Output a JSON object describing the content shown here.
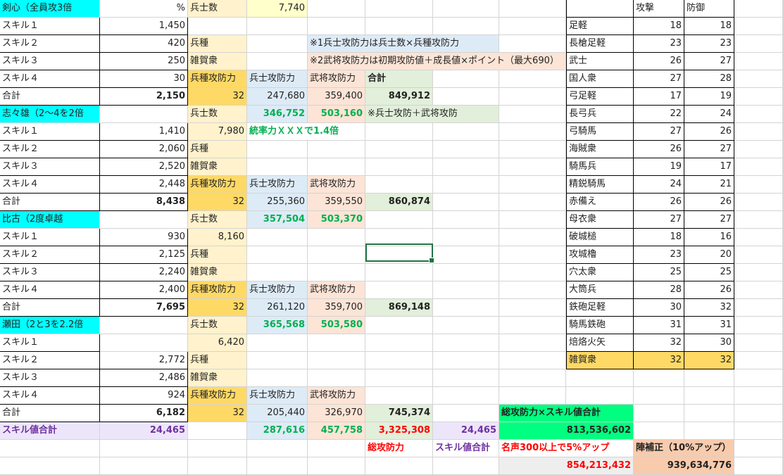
{
  "colors": {
    "cyan": "#00ffff",
    "light_yellow": "#fff2cc",
    "yellow_soft": "#ffffcc",
    "gold": "#ffd966",
    "light_blue": "#ddebf7",
    "peach": "#fce4d6",
    "light_green": "#e2efda",
    "lavender": "#ede6fb",
    "bright_green": "#00ff80",
    "salary_peach": "#f8cbad",
    "grey": "#eeeeee",
    "text_green": "#00b050",
    "text_red": "#ff0000",
    "text_purple": "#7030a0"
  },
  "cells": [
    {
      "t": "剣心（全員攻3倍",
      "c": "A",
      "r": 1,
      "bg": "cyan"
    },
    {
      "t": "%",
      "c": "B",
      "r": 1,
      "a": "r",
      "bg": "white"
    },
    {
      "t": "兵士数",
      "c": "C",
      "r": 1,
      "bg": "light_yellow"
    },
    {
      "t": "7,740",
      "c": "D",
      "r": 1,
      "a": "r",
      "bg": "yellow_soft"
    },
    {
      "t": "スキル１",
      "c": "A",
      "r": 2,
      "bd": 1
    },
    {
      "t": "1,450",
      "c": "B",
      "r": 2,
      "a": "r",
      "bd": 1
    },
    {
      "t": "スキル２",
      "c": "A",
      "r": 3,
      "bd": 1
    },
    {
      "t": "420",
      "c": "B",
      "r": 3,
      "a": "r",
      "bd": 1
    },
    {
      "t": "兵種",
      "c": "C",
      "r": 3,
      "bg": "light_yellow"
    },
    {
      "t": "※1兵士攻防力は兵士数×兵種攻防力",
      "c": "E",
      "r": 3,
      "span": 3,
      "bg": "light_blue"
    },
    {
      "t": "スキル３",
      "c": "A",
      "r": 4,
      "bd": 1
    },
    {
      "t": "250",
      "c": "B",
      "r": 4,
      "a": "r",
      "bd": 1
    },
    {
      "t": "雑賀衆",
      "c": "C",
      "r": 4,
      "bg": "light_yellow"
    },
    {
      "t": "※2武将攻防力は初期攻防値＋成長値×ポイント（最大690）",
      "c": "E",
      "r": 4,
      "span": 4,
      "bg": "peach"
    },
    {
      "t": "スキル４",
      "c": "A",
      "r": 5,
      "bd": 1
    },
    {
      "t": "30",
      "c": "B",
      "r": 5,
      "a": "r",
      "bd": 1
    },
    {
      "t": "兵種攻防力",
      "c": "C",
      "r": 5,
      "bg": "gold"
    },
    {
      "t": "兵士攻防力",
      "c": "D",
      "r": 5,
      "bg": "light_blue"
    },
    {
      "t": "武将攻防力",
      "c": "E",
      "r": 5,
      "bg": "peach"
    },
    {
      "t": "合計",
      "c": "F",
      "r": 5,
      "b": 1,
      "bg": "light_green"
    },
    {
      "t": "合計",
      "c": "A",
      "r": 6,
      "bd": 1
    },
    {
      "t": "2,150",
      "c": "B",
      "r": 6,
      "a": "r",
      "b": 1,
      "bd": 1
    },
    {
      "t": "32",
      "c": "C",
      "r": 6,
      "a": "r",
      "bg": "gold"
    },
    {
      "t": "247,680",
      "c": "D",
      "r": 6,
      "a": "r",
      "bg": "light_blue"
    },
    {
      "t": "359,400",
      "c": "E",
      "r": 6,
      "a": "r",
      "bg": "peach"
    },
    {
      "t": "849,912",
      "c": "F",
      "r": 6,
      "a": "r",
      "b": 1,
      "bg": "light_green"
    },
    {
      "t": "志々雄（2～4を2倍",
      "c": "A",
      "r": 7,
      "bg": "cyan"
    },
    {
      "t": "兵士数",
      "c": "C",
      "r": 7,
      "bg": "light_yellow"
    },
    {
      "t": "346,752",
      "c": "D",
      "r": 7,
      "a": "r",
      "b": 1,
      "fg": "text_green",
      "bg": "light_blue"
    },
    {
      "t": "503,160",
      "c": "E",
      "r": 7,
      "a": "r",
      "b": 1,
      "fg": "text_green",
      "bg": "peach"
    },
    {
      "t": "※兵士攻防＋武将攻防",
      "c": "F",
      "r": 7,
      "span": 2,
      "bg": "light_green"
    },
    {
      "t": "スキル１",
      "c": "A",
      "r": 8,
      "bd": 1
    },
    {
      "t": "1,410",
      "c": "B",
      "r": 8,
      "a": "r",
      "bd": 1
    },
    {
      "t": "7,980",
      "c": "C",
      "r": 8,
      "a": "r",
      "bg": "light_yellow"
    },
    {
      "t": "統率力ＸＸＸで1.4倍",
      "c": "D",
      "r": 8,
      "span": 2,
      "b": 1,
      "fg": "text_green"
    },
    {
      "t": "スキル２",
      "c": "A",
      "r": 9,
      "bd": 1
    },
    {
      "t": "2,060",
      "c": "B",
      "r": 9,
      "a": "r",
      "bd": 1
    },
    {
      "t": "兵種",
      "c": "C",
      "r": 9,
      "bg": "light_yellow"
    },
    {
      "t": "スキル３",
      "c": "A",
      "r": 10,
      "bd": 1
    },
    {
      "t": "2,520",
      "c": "B",
      "r": 10,
      "a": "r",
      "bd": 1
    },
    {
      "t": "雑賀衆",
      "c": "C",
      "r": 10,
      "bg": "light_yellow"
    },
    {
      "t": "スキル４",
      "c": "A",
      "r": 11,
      "bd": 1
    },
    {
      "t": "2,448",
      "c": "B",
      "r": 11,
      "a": "r",
      "bd": 1
    },
    {
      "t": "兵種攻防力",
      "c": "C",
      "r": 11,
      "bg": "gold"
    },
    {
      "t": "兵士攻防力",
      "c": "D",
      "r": 11,
      "bg": "light_blue"
    },
    {
      "t": "武将攻防力",
      "c": "E",
      "r": 11,
      "bg": "peach"
    },
    {
      "t": "合計",
      "c": "A",
      "r": 12,
      "bd": 1
    },
    {
      "t": "8,438",
      "c": "B",
      "r": 12,
      "a": "r",
      "b": 1,
      "bd": 1
    },
    {
      "t": "32",
      "c": "C",
      "r": 12,
      "a": "r",
      "bg": "gold"
    },
    {
      "t": "255,360",
      "c": "D",
      "r": 12,
      "a": "r",
      "bg": "light_blue"
    },
    {
      "t": "359,550",
      "c": "E",
      "r": 12,
      "a": "r",
      "bg": "peach"
    },
    {
      "t": "860,874",
      "c": "F",
      "r": 12,
      "a": "r",
      "b": 1,
      "bg": "light_green"
    },
    {
      "t": "比古（2度卓越",
      "c": "A",
      "r": 13,
      "bg": "cyan"
    },
    {
      "t": "兵士数",
      "c": "C",
      "r": 13,
      "bg": "light_yellow"
    },
    {
      "t": "357,504",
      "c": "D",
      "r": 13,
      "a": "r",
      "b": 1,
      "fg": "text_green",
      "bg": "light_blue"
    },
    {
      "t": "503,370",
      "c": "E",
      "r": 13,
      "a": "r",
      "b": 1,
      "fg": "text_green",
      "bg": "peach"
    },
    {
      "t": "スキル１",
      "c": "A",
      "r": 14,
      "bd": 1
    },
    {
      "t": "930",
      "c": "B",
      "r": 14,
      "a": "r",
      "bd": 1
    },
    {
      "t": "8,160",
      "c": "C",
      "r": 14,
      "a": "r",
      "bg": "light_yellow"
    },
    {
      "t": "スキル２",
      "c": "A",
      "r": 15,
      "bd": 1
    },
    {
      "t": "2,125",
      "c": "B",
      "r": 15,
      "a": "r",
      "bd": 1
    },
    {
      "t": "兵種",
      "c": "C",
      "r": 15,
      "bg": "light_yellow"
    },
    {
      "t": "スキル３",
      "c": "A",
      "r": 16,
      "bd": 1
    },
    {
      "t": "2,240",
      "c": "B",
      "r": 16,
      "a": "r",
      "bd": 1
    },
    {
      "t": "雑賀衆",
      "c": "C",
      "r": 16,
      "bg": "light_yellow"
    },
    {
      "t": "スキル４",
      "c": "A",
      "r": 17,
      "bd": 1
    },
    {
      "t": "2,400",
      "c": "B",
      "r": 17,
      "a": "r",
      "bd": 1
    },
    {
      "t": "兵種攻防力",
      "c": "C",
      "r": 17,
      "bg": "gold"
    },
    {
      "t": "兵士攻防力",
      "c": "D",
      "r": 17,
      "bg": "light_blue"
    },
    {
      "t": "武将攻防力",
      "c": "E",
      "r": 17,
      "bg": "peach"
    },
    {
      "t": "合計",
      "c": "A",
      "r": 18,
      "bd": 1
    },
    {
      "t": "7,695",
      "c": "B",
      "r": 18,
      "a": "r",
      "b": 1,
      "bd": 1
    },
    {
      "t": "32",
      "c": "C",
      "r": 18,
      "a": "r",
      "bg": "gold"
    },
    {
      "t": "261,120",
      "c": "D",
      "r": 18,
      "a": "r",
      "bg": "light_blue"
    },
    {
      "t": "359,700",
      "c": "E",
      "r": 18,
      "a": "r",
      "bg": "peach"
    },
    {
      "t": "869,148",
      "c": "F",
      "r": 18,
      "a": "r",
      "b": 1,
      "bg": "light_green"
    },
    {
      "t": "瀬田（2と3を2.2倍",
      "c": "A",
      "r": 19,
      "bg": "cyan"
    },
    {
      "t": "兵士数",
      "c": "C",
      "r": 19,
      "bg": "light_yellow"
    },
    {
      "t": "365,568",
      "c": "D",
      "r": 19,
      "a": "r",
      "b": 1,
      "fg": "text_green",
      "bg": "light_blue"
    },
    {
      "t": "503,580",
      "c": "E",
      "r": 19,
      "a": "r",
      "b": 1,
      "fg": "text_green",
      "bg": "peach"
    },
    {
      "t": "スキル１",
      "c": "A",
      "r": 20,
      "bd": 1
    },
    {
      "t": "6,420",
      "c": "C",
      "r": 20,
      "a": "r",
      "bg": "light_yellow"
    },
    {
      "t": "スキル２",
      "c": "A",
      "r": 21,
      "bd": 1
    },
    {
      "t": "2,772",
      "c": "B",
      "r": 21,
      "a": "r",
      "bd": 1
    },
    {
      "t": "兵種",
      "c": "C",
      "r": 21,
      "bg": "light_yellow"
    },
    {
      "t": "スキル３",
      "c": "A",
      "r": 22,
      "bd": 1
    },
    {
      "t": "2,486",
      "c": "B",
      "r": 22,
      "a": "r",
      "bd": 1
    },
    {
      "t": "雑賀衆",
      "c": "C",
      "r": 22,
      "bg": "light_yellow"
    },
    {
      "t": "スキル４",
      "c": "A",
      "r": 23,
      "bd": 1
    },
    {
      "t": "924",
      "c": "B",
      "r": 23,
      "a": "r",
      "bd": 1
    },
    {
      "t": "兵種攻防力",
      "c": "C",
      "r": 23,
      "bg": "gold"
    },
    {
      "t": "兵士攻防力",
      "c": "D",
      "r": 23,
      "bg": "light_blue"
    },
    {
      "t": "武将攻防力",
      "c": "E",
      "r": 23,
      "bg": "peach"
    },
    {
      "t": "合計",
      "c": "A",
      "r": 24,
      "bd": 1
    },
    {
      "t": "6,182",
      "c": "B",
      "r": 24,
      "a": "r",
      "b": 1,
      "bd": 1
    },
    {
      "t": "32",
      "c": "C",
      "r": 24,
      "a": "r",
      "bg": "gold"
    },
    {
      "t": "205,440",
      "c": "D",
      "r": 24,
      "a": "r",
      "bg": "light_blue"
    },
    {
      "t": "326,970",
      "c": "E",
      "r": 24,
      "a": "r",
      "bg": "peach"
    },
    {
      "t": "745,374",
      "c": "F",
      "r": 24,
      "a": "r",
      "b": 1,
      "bg": "light_green"
    },
    {
      "t": "総攻防力×スキル値合計",
      "c": "H",
      "r": 24,
      "span": 2,
      "b": 1,
      "bg": "bright_green"
    },
    {
      "t": "スキル値合計",
      "c": "A",
      "r": 25,
      "b": 1,
      "fg": "text_purple",
      "bg": "lavender"
    },
    {
      "t": "24,465",
      "c": "B",
      "r": 25,
      "a": "r",
      "b": 1,
      "fg": "text_purple",
      "bg": "lavender"
    },
    {
      "t": "287,616",
      "c": "D",
      "r": 25,
      "a": "r",
      "b": 1,
      "fg": "text_green",
      "bg": "light_blue"
    },
    {
      "t": "457,758",
      "c": "E",
      "r": 25,
      "a": "r",
      "b": 1,
      "fg": "text_green",
      "bg": "peach"
    },
    {
      "t": "3,325,308",
      "c": "F",
      "r": 25,
      "a": "r",
      "b": 1,
      "fg": "text_red",
      "bg": "light_green"
    },
    {
      "t": "24,465",
      "c": "G",
      "r": 25,
      "a": "r",
      "b": 1,
      "fg": "text_purple",
      "bg": "lavender"
    },
    {
      "t": "813,536,602",
      "c": "H",
      "r": 25,
      "span": 2,
      "a": "r",
      "b": 1,
      "bg": "bright_green"
    },
    {
      "t": "総攻防力",
      "c": "F",
      "r": 26,
      "b": 1,
      "fg": "text_red"
    },
    {
      "t": "スキル値合計",
      "c": "G",
      "r": 26,
      "b": 1,
      "fg": "text_purple"
    },
    {
      "t": "名声300以上で5%アップ",
      "c": "H",
      "r": 26,
      "span": 2,
      "b": 1,
      "fg": "text_red"
    },
    {
      "t": "陣補正（10%アップ）",
      "c": "J",
      "r": 26,
      "span": 2,
      "b": 1,
      "bg": "salary_peach"
    },
    {
      "t": "854,213,432",
      "c": "H",
      "r": 27,
      "span": 2,
      "a": "r",
      "b": 1,
      "fg": "text_red",
      "bg": "grey"
    },
    {
      "t": "939,634,776",
      "c": "J",
      "r": 27,
      "span": 2,
      "a": "r",
      "b": 1,
      "bg": "salary_peach"
    }
  ],
  "unit_table": {
    "header": {
      "attack": "攻撃",
      "defense": "防御"
    },
    "rows": [
      {
        "name": "足軽",
        "atk": "18",
        "def": "18"
      },
      {
        "name": "長槍足軽",
        "atk": "23",
        "def": "23"
      },
      {
        "name": "武士",
        "atk": "26",
        "def": "27"
      },
      {
        "name": "国人衆",
        "atk": "27",
        "def": "28"
      },
      {
        "name": "弓足軽",
        "atk": "17",
        "def": "19"
      },
      {
        "name": "長弓兵",
        "atk": "22",
        "def": "24"
      },
      {
        "name": "弓騎馬",
        "atk": "27",
        "def": "26"
      },
      {
        "name": "海賊衆",
        "atk": "26",
        "def": "27"
      },
      {
        "name": "騎馬兵",
        "atk": "19",
        "def": "17"
      },
      {
        "name": "精鋭騎馬",
        "atk": "24",
        "def": "21"
      },
      {
        "name": "赤備え",
        "atk": "26",
        "def": "26"
      },
      {
        "name": "母衣衆",
        "atk": "27",
        "def": "27"
      },
      {
        "name": "破城槌",
        "atk": "18",
        "def": "16"
      },
      {
        "name": "攻城櫓",
        "atk": "23",
        "def": "20"
      },
      {
        "name": "穴太衆",
        "atk": "25",
        "def": "25"
      },
      {
        "name": "大筒兵",
        "atk": "28",
        "def": "26"
      },
      {
        "name": "鉄砲足軽",
        "atk": "30",
        "def": "32"
      },
      {
        "name": "騎馬鉄砲",
        "atk": "31",
        "def": "31"
      },
      {
        "name": "焙烙火矢",
        "atk": "32",
        "def": "30"
      },
      {
        "name": "雑賀衆",
        "atk": "32",
        "def": "32",
        "highlight": true
      }
    ]
  }
}
